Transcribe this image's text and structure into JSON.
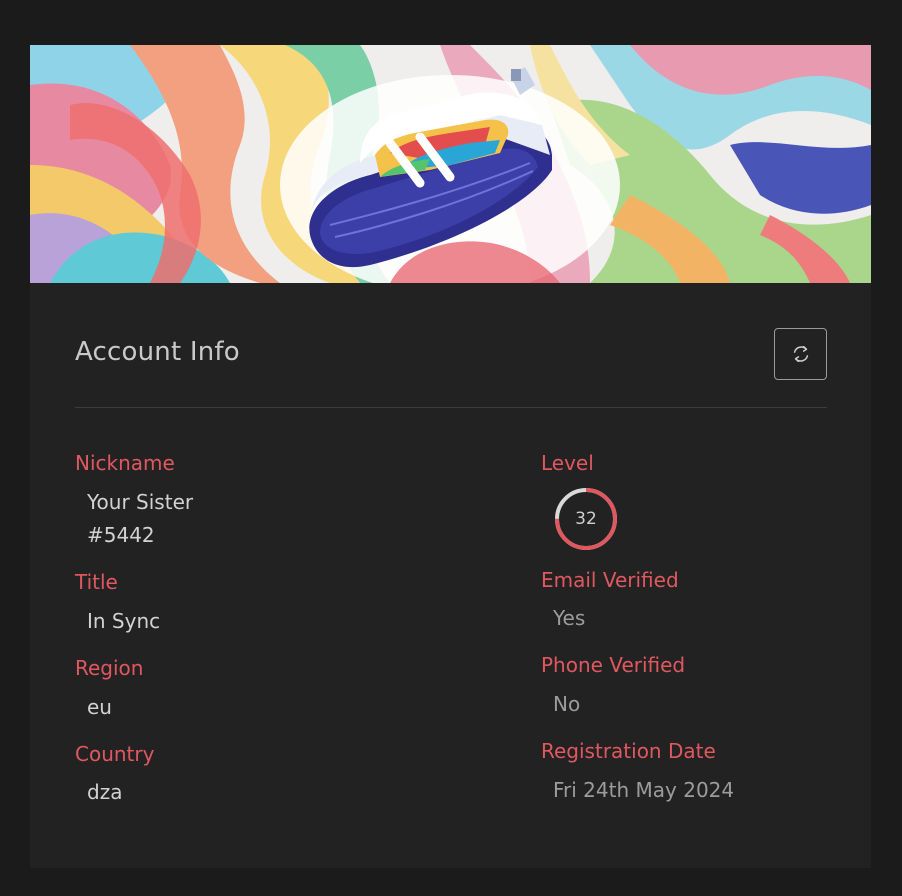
{
  "panel": {
    "title": "Account Info"
  },
  "fields": {
    "nickname": {
      "label": "Nickname",
      "line1": "Your Sister",
      "line2": "#5442"
    },
    "title": {
      "label": "Title",
      "value": "In Sync"
    },
    "region": {
      "label": "Region",
      "value": "eu"
    },
    "country": {
      "label": "Country",
      "value": "dza"
    },
    "level": {
      "label": "Level",
      "value": "32",
      "progress_percent": 75
    },
    "email_verified": {
      "label": "Email Verified",
      "value": "Yes"
    },
    "phone_verified": {
      "label": "Phone Verified",
      "value": "No"
    },
    "registration_date": {
      "label": "Registration Date",
      "value": "Fri 24th May 2024"
    }
  },
  "icons": {
    "refresh": "refresh-icon",
    "banner": "sneaker-banner-image"
  },
  "colors": {
    "background": "#1c1b1c",
    "card": "#232223",
    "label": "#e0585f",
    "value": "#d2d2d2",
    "gauge_track": "#d9d9d9",
    "gauge_fill": "#e0585f"
  }
}
